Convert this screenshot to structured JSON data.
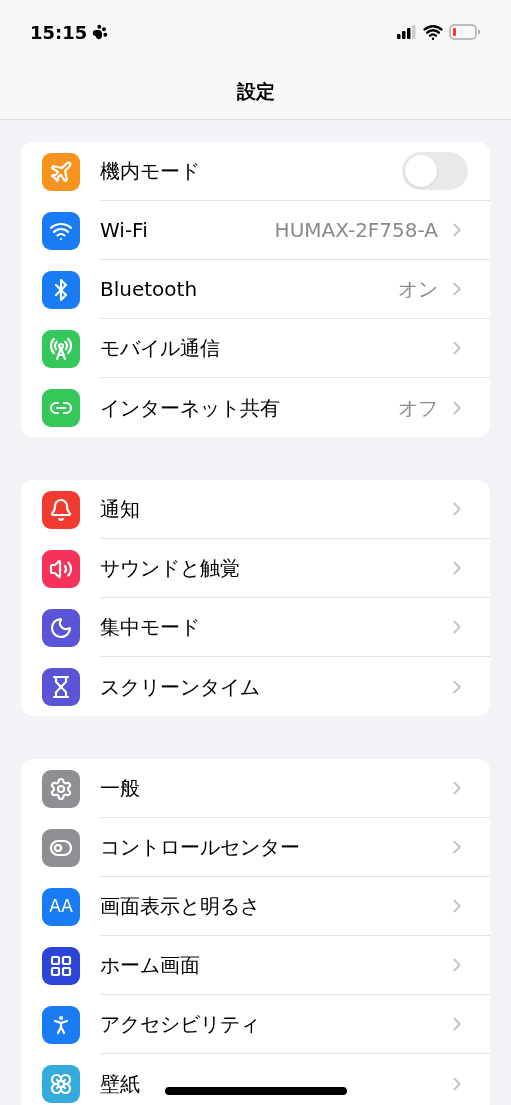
{
  "status_bar": {
    "time": "15:15"
  },
  "nav": {
    "title": "設定"
  },
  "groups": [
    {
      "rows": [
        {
          "label": "機内モード",
          "kind": "toggle",
          "on": false,
          "color": "#f7931e"
        },
        {
          "label": "Wi-Fi",
          "kind": "link",
          "value": "HUMAX-2F758-A",
          "color": "#1a7cf5"
        },
        {
          "label": "Bluetooth",
          "kind": "link",
          "value": "オン",
          "color": "#1a7cf5"
        },
        {
          "label": "モバイル通信",
          "kind": "link",
          "color": "#34c759"
        },
        {
          "label": "インターネット共有",
          "kind": "link",
          "value": "オフ",
          "color": "#34c759"
        }
      ]
    },
    {
      "rows": [
        {
          "label": "通知",
          "kind": "link",
          "color": "#f23b30"
        },
        {
          "label": "サウンドと触覚",
          "kind": "link",
          "color": "#f5325a"
        },
        {
          "label": "集中モード",
          "kind": "link",
          "color": "#5a55d6"
        },
        {
          "label": "スクリーンタイム",
          "kind": "link",
          "color": "#5a55d6"
        }
      ]
    },
    {
      "rows": [
        {
          "label": "一般",
          "kind": "link",
          "color": "#8e8e93"
        },
        {
          "label": "コントロールセンター",
          "kind": "link",
          "color": "#8e8e93"
        },
        {
          "label": "画面表示と明るさ",
          "kind": "link",
          "color": "#1a7cf5",
          "icon_text": "AA"
        },
        {
          "label": "ホーム画面",
          "kind": "link",
          "color": "#2c44d8"
        },
        {
          "label": "アクセシビリティ",
          "kind": "link",
          "color": "#1a7cf5"
        },
        {
          "label": "壁紙",
          "kind": "link",
          "color": "#35aadc"
        }
      ]
    }
  ]
}
